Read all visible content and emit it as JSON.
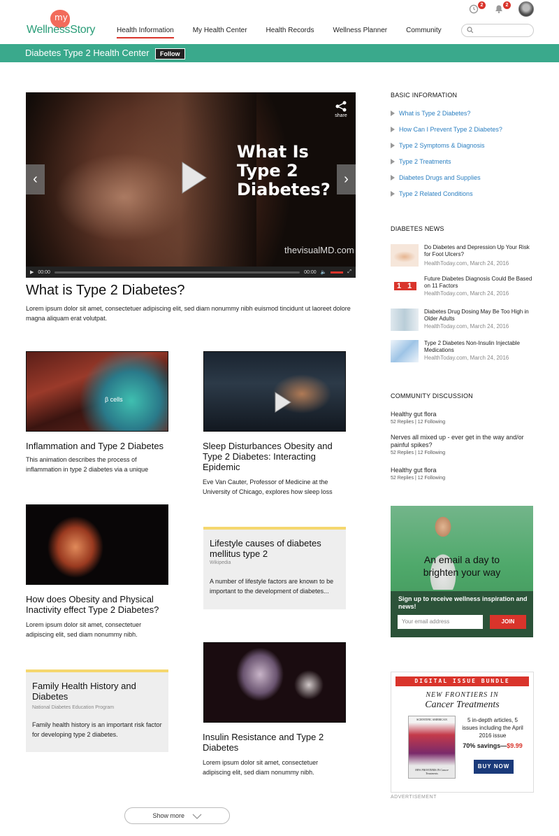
{
  "header": {
    "logo_my": "my",
    "logo_name": "WellnessStory",
    "nav": [
      {
        "label": "Health Information"
      },
      {
        "label": "My Health Center"
      },
      {
        "label": "Health Records"
      },
      {
        "label": "Wellness Planner"
      },
      {
        "label": "Community"
      }
    ],
    "active_nav": "Health Information",
    "notifications": {
      "reminders": "2",
      "alerts": "2"
    },
    "search_placeholder": ""
  },
  "bar": {
    "title": "Diabetes Type 2 Health Center",
    "follow": "Follow"
  },
  "hero": {
    "video_title_overlay": "What Is Type 2 Diabetes?",
    "brand": "thevisualMD.com",
    "share": "share",
    "time_current": "00:00",
    "time_total": "00:00",
    "title": "What is Type 2 Diabetes?",
    "description": "Lorem ipsum dolor sit amet, consectetuer adipiscing elit, sed diam nonummy nibh euismod tincidunt ut laoreet dolore magna aliquam erat volutpat."
  },
  "cards": {
    "c1": {
      "title": "Inflammation and Type 2 Diabetes",
      "desc": "This animation describes the process of inflammation in type 2 diabetes via a unique",
      "img_label": "β cells"
    },
    "c2": {
      "title": "Sleep Disturbances Obesity and Type 2 Diabetes: Interacting Epidemic",
      "desc": "Eve Van Cauter, Professor of Medicine at the University of Chicago, explores how sleep loss"
    },
    "c3": {
      "title": "How does Obesity and Physical Inactivity effect Type 2 Diabetes?",
      "desc": "Lorem ipsum dolor sit amet, consectetuer adipiscing elit, sed diam nonummy nibh."
    },
    "t1": {
      "title": "Lifestyle causes of diabetes mellitus type 2",
      "source": "Wikipedia",
      "body": "A number of lifestyle factors are known to be important to the development of diabetes..."
    },
    "t2": {
      "title": "Family Health History and Diabetes",
      "source": "National Diabetes Education Program",
      "body": "Family health history is an important risk factor for developing type 2 diabetes."
    },
    "c4": {
      "title": "Insulin Resistance and Type 2 Diabetes",
      "desc": "Lorem ipsum dolor sit amet, consectetuer adipiscing elit, sed diam nonummy nibh."
    }
  },
  "basic": {
    "heading": "BASIC INFORMATION",
    "items": [
      {
        "label": "What is Type 2 Diabetes?"
      },
      {
        "label": "How Can I Prevent Type 2 Diabetes?"
      },
      {
        "label": "Type 2 Symptoms & Diagnosis"
      },
      {
        "label": "Type 2 Treatments"
      },
      {
        "label": "Diabetes Drugs and Supplies"
      },
      {
        "label": "Type 2 Related Conditions"
      }
    ]
  },
  "news": {
    "heading": "DIABETES NEWS",
    "items": [
      {
        "title": "Do Diabetes and Depression Up Your Risk for Foot Ulcers?",
        "meta": "HealthToday.com, March 24, 2016"
      },
      {
        "title": "Future Diabetes Diagnosis Could Be Based on 11 Factors",
        "meta": "HealthToday.com, March 24, 2016"
      },
      {
        "title": "Diabetes Drug Dosing May Be Too High in Older Adults",
        "meta": "HealthToday.com, March 24, 2016"
      },
      {
        "title": "Type 2 Diabetes Non-Insulin Injectable Medications",
        "meta": "HealthToday.com, March 24, 2016"
      }
    ],
    "thumb2_text": "1 1"
  },
  "community": {
    "heading": "COMMUNITY DISCUSSION",
    "items": [
      {
        "title": "Healthy gut flora",
        "meta": "52 Replies  |  12 Following"
      },
      {
        "title": "Nerves all mixed up - ever get in the way and/or painful spikes?",
        "meta": "52 Replies  |  12 Following"
      },
      {
        "title": "Healthy gut flora",
        "meta": "52 Replies  |  12 Following"
      }
    ]
  },
  "promo": {
    "title_line1": "An email a day to",
    "title_line2": "brighten your way",
    "signup": "Sign up to receive wellness inspiration and news!",
    "email_placeholder": "Your email address",
    "join": "JOIN"
  },
  "ad": {
    "bar": "DIGITAL ISSUE BUNDLE",
    "title1": "NEW FRONTIERS IN",
    "title2": "Cancer Treatments",
    "cover_top": "SCIENTIFIC AMERICAN",
    "cover_bottom": "NEW FRONTIERS IN Cancer Treatments",
    "text": "5 in-depth articles, 5 issues including the April 2016 issue",
    "price_label": "70% savings—",
    "price": "$9.99",
    "buy": "BUY NOW",
    "label": "ADVERTISEMENT"
  },
  "show_more": "Show more",
  "colors": {
    "brand_green": "#3aa98c",
    "accent_red": "#d9342b",
    "link_blue": "#2b7fc1",
    "card_yellow": "#f5d76e"
  }
}
